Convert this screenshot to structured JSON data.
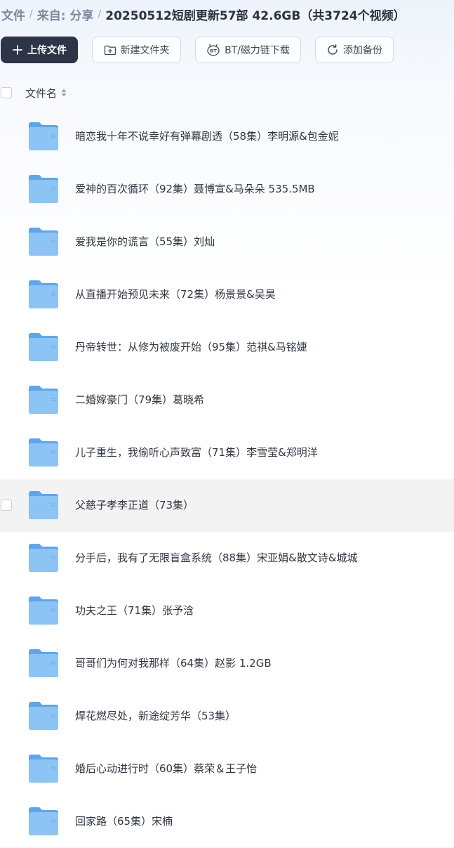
{
  "breadcrumb": {
    "root": "文件",
    "from": "来自:",
    "share": "分享",
    "current": "20250512短剧更新57部 42.6GB（共3724个视频）",
    "separator": "/"
  },
  "toolbar": {
    "upload_label": "上传文件",
    "new_folder_label": "新建文件夹",
    "bt_label": "BT/磁力链下载",
    "backup_label": "添加备份"
  },
  "list_header": {
    "name_label": "文件名"
  },
  "files": [
    {
      "name": "暗恋我十年不说幸好有弹幕剧透（58集）李明源&包金妮"
    },
    {
      "name": "爱神的百次循环（92集）聂博宣&马朵朵 535.5MB"
    },
    {
      "name": "爱我是你的谎言（55集）刘灿"
    },
    {
      "name": "从直播开始预见未来（72集）杨景景&吴昊"
    },
    {
      "name": "丹帝转世：从修为被废开始（95集）范祺&马铭婕"
    },
    {
      "name": "二婚嫁豪门（79集）葛晓希"
    },
    {
      "name": "儿子重生，我偷听心声致富（71集）李雪莹&郑明洋"
    },
    {
      "name": "父慈子孝李正道（73集）"
    },
    {
      "name": "分手后，我有了无限盲盒系统（88集）宋亚娟&散文诗&城城"
    },
    {
      "name": "功夫之王（71集）张予浛"
    },
    {
      "name": "哥哥们为何对我那样（64集）赵影 1.2GB"
    },
    {
      "name": "焊花燃尽处，新途绽芳华（53集）"
    },
    {
      "name": "婚后心动进行时（60集）蔡荣＆王子怡"
    },
    {
      "name": "回家路（65集）宋楠"
    }
  ],
  "icons": {
    "upload": "plus-icon",
    "new_folder": "folder-plus-icon",
    "bt": "bt-icon",
    "backup": "refresh-icon",
    "sort": "sort-icon",
    "folder": "folder-icon"
  },
  "colors": {
    "primary_button": "#2e3546",
    "folder": "#7cb8f2",
    "hover_row": "#f3f3f4"
  }
}
